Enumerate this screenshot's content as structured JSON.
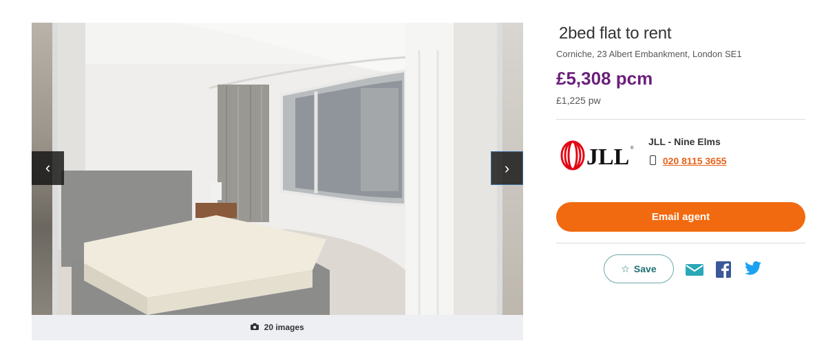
{
  "gallery": {
    "prev_label": "‹",
    "next_label": "›",
    "image_count": "20 images",
    "image_count_icon": "camera-icon"
  },
  "listing": {
    "title": "2bed flat to rent",
    "address": "Corniche, 23 Albert Embankment, London SE1",
    "price_pcm": "£5,308 pcm",
    "price_pw": "£1,225 pw"
  },
  "agent": {
    "logo_text": "JLL",
    "name": "JLL - Nine Elms",
    "phone": "020 8115 3655",
    "phone_icon": "mobile-phone-icon"
  },
  "actions": {
    "email_label": "Email agent",
    "save_label": "Save",
    "save_icon": "star-outline-icon",
    "share_icons": [
      "email-icon",
      "facebook-icon",
      "twitter-icon"
    ]
  },
  "colors": {
    "price": "#6a1f7a",
    "accent_orange": "#f26a0f",
    "save_teal": "#1f6f73",
    "share_teal": "#2aa7b8",
    "facebook": "#3b5998",
    "twitter": "#1da1f2",
    "logo_red": "#e30613"
  }
}
